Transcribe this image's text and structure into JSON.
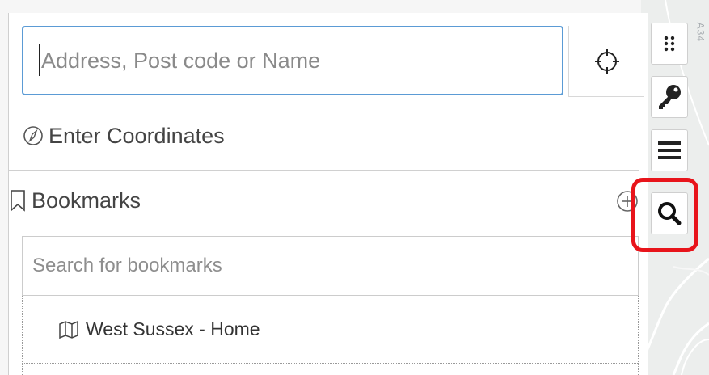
{
  "search": {
    "placeholder": "Address, Post code or Name",
    "locate_icon": "crosshair-icon"
  },
  "coordinates": {
    "label": "Enter Coordinates",
    "icon": "compass-icon"
  },
  "bookmarks": {
    "label": "Bookmarks",
    "icon": "bookmark-icon",
    "add_icon": "plus-circle-icon",
    "search_placeholder": "Search for bookmarks",
    "items": [
      {
        "label": "West Sussex - Home",
        "icon": "map-icon"
      }
    ]
  },
  "map": {
    "road_label": "A34"
  },
  "toolbar": {
    "items": [
      {
        "name": "grid",
        "icon": "grid-dots-icon"
      },
      {
        "name": "key",
        "icon": "key-icon"
      },
      {
        "name": "menu",
        "icon": "hamburger-icon"
      },
      {
        "name": "search",
        "icon": "search-icon",
        "highlighted": true
      }
    ],
    "highlight_color": "#e8141b"
  },
  "colors": {
    "input_focus": "#5b9bd5",
    "text": "#444444"
  }
}
